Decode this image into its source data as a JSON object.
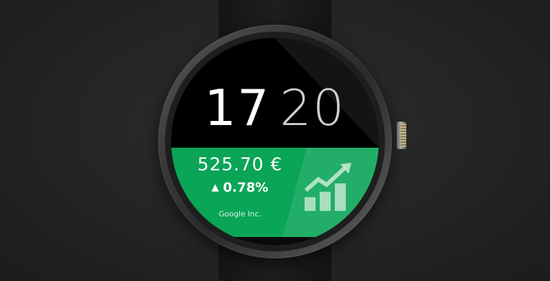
{
  "watch_face": {
    "time": {
      "hours": "17",
      "minutes": "20"
    },
    "stock": {
      "price": "525.70 €",
      "change": "0.78%",
      "change_direction_icon": "triangle-up-icon",
      "company": "Google Inc.",
      "trend_icon": "trending-up-chart-icon"
    }
  },
  "colors": {
    "panel_green": "#0aa557",
    "face_black": "#0a0a0a",
    "text_white": "#ffffff"
  }
}
